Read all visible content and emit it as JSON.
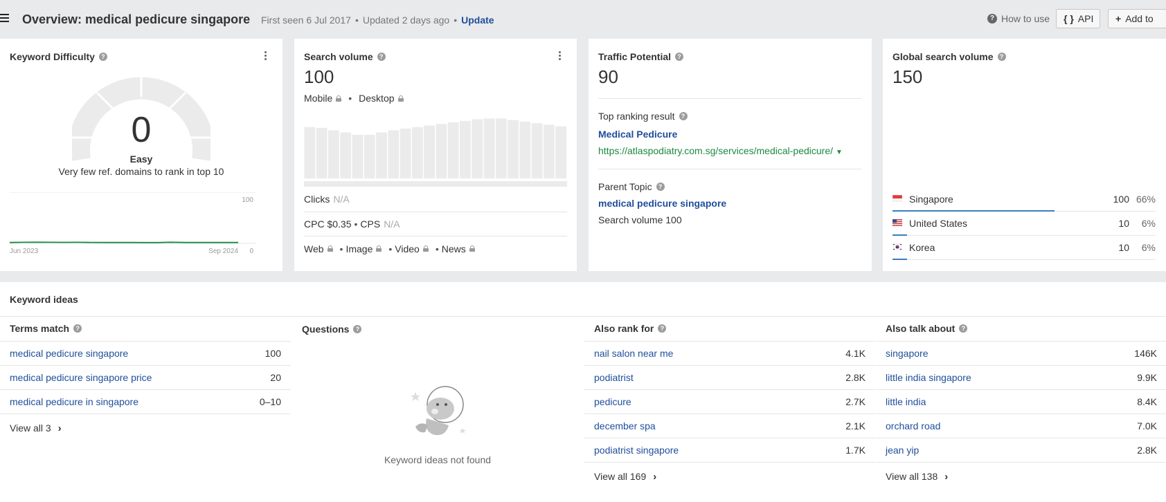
{
  "header": {
    "title": "Overview: medical pedicure singapore",
    "first_seen": "First seen 6 Jul 2017",
    "updated": "Updated 2 days ago",
    "update_link": "Update",
    "how_to_use": "How to use",
    "api_label": "API",
    "add_to_label": "Add to"
  },
  "keyword_difficulty": {
    "title": "Keyword Difficulty",
    "value": "0",
    "label": "Easy",
    "description": "Very few ref. domains to rank in top 10",
    "chart_data": {
      "type": "line",
      "x_start": "Jun 2023",
      "x_end": "Sep 2024",
      "ylim": [
        0,
        100
      ],
      "y_ticks": [
        "100",
        "0"
      ],
      "values": [
        1.8,
        2.2,
        2.3,
        2.1,
        2.0,
        2.1,
        1.9,
        1.8,
        1.7,
        1.7,
        1.6,
        1.6,
        2.3,
        1.8,
        1.7,
        1.8,
        1.7,
        1.7
      ],
      "color": "#1b8a3e"
    }
  },
  "search_volume": {
    "title": "Search volume",
    "value": "100",
    "mobile": "Mobile",
    "desktop": "Desktop",
    "chart_data": {
      "type": "bar",
      "values": [
        66,
        65,
        62,
        59,
        56,
        56,
        59,
        62,
        64,
        66,
        68,
        70,
        72,
        74,
        76,
        77,
        77,
        75,
        73,
        71,
        69,
        67
      ],
      "color": "#ebebeb"
    },
    "clicks_label": "Clicks",
    "clicks_value": "N/A",
    "cpc": "CPC $0.35",
    "cps_label": "CPS",
    "cps_value": "N/A",
    "web": "Web",
    "image": "Image",
    "video": "Video",
    "news": "News"
  },
  "traffic_potential": {
    "title": "Traffic Potential",
    "value": "90",
    "top_ranking_label": "Top ranking result",
    "top_ranking_title": "Medical Pedicure",
    "top_ranking_url": "https://atlaspodiatry.com.sg/services/medical-pedicure/",
    "parent_topic_label": "Parent Topic",
    "parent_topic": "medical pedicure singapore",
    "parent_volume": "Search volume 100"
  },
  "global_volume": {
    "title": "Global search volume",
    "value": "150",
    "countries": [
      {
        "name": "Singapore",
        "volume": "100",
        "percent": "66%",
        "share": 0.66,
        "flag": "flag-sg"
      },
      {
        "name": "United States",
        "volume": "10",
        "percent": "6%",
        "share": 0.06,
        "flag": "flag-us"
      },
      {
        "name": "Korea",
        "volume": "10",
        "percent": "6%",
        "share": 0.06,
        "flag": "flag-kr"
      }
    ]
  },
  "keyword_ideas": {
    "title": "Keyword ideas",
    "terms_match": {
      "header": "Terms match",
      "rows": [
        {
          "keyword": "medical pedicure singapore",
          "volume": "100"
        },
        {
          "keyword": "medical pedicure singapore price",
          "volume": "20"
        },
        {
          "keyword": "medical pedicure in singapore",
          "volume": "0–10"
        }
      ],
      "view_all": "View all 3"
    },
    "questions": {
      "header": "Questions",
      "empty_text": "Keyword ideas not found"
    },
    "also_rank_for": {
      "header": "Also rank for",
      "rows": [
        {
          "keyword": "nail salon near me",
          "volume": "4.1K"
        },
        {
          "keyword": "podiatrist",
          "volume": "2.8K"
        },
        {
          "keyword": "pedicure",
          "volume": "2.7K"
        },
        {
          "keyword": "december spa",
          "volume": "2.1K"
        },
        {
          "keyword": "podiatrist singapore",
          "volume": "1.7K"
        }
      ],
      "view_all": "View all 169"
    },
    "also_talk_about": {
      "header": "Also talk about",
      "rows": [
        {
          "keyword": "singapore",
          "volume": "146K"
        },
        {
          "keyword": "little india singapore",
          "volume": "9.9K"
        },
        {
          "keyword": "little india",
          "volume": "8.4K"
        },
        {
          "keyword": "orchard road",
          "volume": "7.0K"
        },
        {
          "keyword": "jean yip",
          "volume": "2.8K"
        }
      ],
      "view_all": "View all 138"
    }
  }
}
